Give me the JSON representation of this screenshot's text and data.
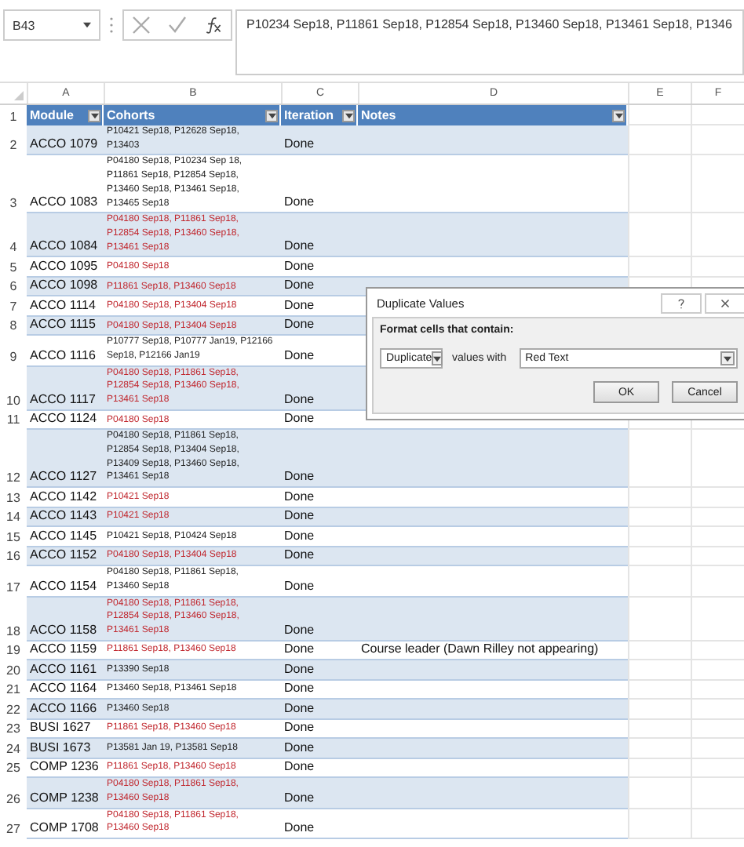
{
  "name_box": "B43",
  "formula": "P10234 Sep18, P11861 Sep18, P12854 Sep18, P13460 Sep18, P13461 Sep18, P1346",
  "columns": [
    "A",
    "B",
    "C",
    "D",
    "E",
    "F"
  ],
  "header": {
    "num": "1",
    "cells": [
      "Module",
      "Cohorts",
      "Iteration",
      "Notes"
    ]
  },
  "rows": [
    {
      "num": "2",
      "module": "ACCO 1079",
      "cohorts": "P10421 Sep18, P12628 Sep18,\nP13403",
      "duplicate": false,
      "iteration": "Done"
    },
    {
      "num": "3",
      "module": "ACCO 1083",
      "cohorts": "P04180 Sep18, P10234 Sep 18,\nP11861 Sep18, P12854 Sep18,\nP13460 Sep18, P13461 Sep18,\nP13465 Sep18",
      "duplicate": false,
      "iteration": "Done"
    },
    {
      "num": "4",
      "module": "ACCO 1084",
      "cohorts": "P04180 Sep18, P11861 Sep18,\nP12854 Sep18, P13460 Sep18,\nP13461 Sep18",
      "duplicate": true,
      "iteration": "Done"
    },
    {
      "num": "5",
      "module": "ACCO 1095",
      "cohorts": "P04180 Sep18",
      "duplicate": true,
      "iteration": "Done"
    },
    {
      "num": "6",
      "module": "ACCO 1098",
      "cohorts": "P11861 Sep18, P13460 Sep18",
      "duplicate": true,
      "iteration": "Done"
    },
    {
      "num": "7",
      "module": "ACCO 1114",
      "cohorts": "P04180 Sep18, P13404 Sep18",
      "duplicate": true,
      "iteration": "Done"
    },
    {
      "num": "8",
      "module": "ACCO 1115",
      "cohorts": "P04180 Sep18, P13404 Sep18",
      "duplicate": true,
      "iteration": "Done"
    },
    {
      "num": "9",
      "module": "ACCO 1116",
      "cohorts": "P10777 Sep18, P10777 Jan19, P12166\nSep18, P12166 Jan19",
      "duplicate": false,
      "iteration": "Done"
    },
    {
      "num": "10",
      "module": "ACCO 1117",
      "cohorts": "P04180 Sep18, P11861 Sep18,\nP12854 Sep18, P13460 Sep18,\nP13461 Sep18",
      "duplicate": true,
      "iteration": "Done"
    },
    {
      "num": "11",
      "module": "ACCO 1124",
      "cohorts": "P04180 Sep18",
      "duplicate": true,
      "iteration": "Done"
    },
    {
      "num": "12",
      "module": "ACCO 1127",
      "cohorts": "P04180 Sep18, P11861 Sep18,\nP12854 Sep18, P13404 Sep18,\nP13409 Sep18, P13460 Sep18,\nP13461 Sep18",
      "duplicate": false,
      "iteration": "Done"
    },
    {
      "num": "13",
      "module": "ACCO 1142",
      "cohorts": "P10421 Sep18",
      "duplicate": true,
      "iteration": "Done"
    },
    {
      "num": "14",
      "module": "ACCO 1143",
      "cohorts": "P10421 Sep18",
      "duplicate": true,
      "iteration": "Done"
    },
    {
      "num": "15",
      "module": "ACCO 1145",
      "cohorts": "P10421 Sep18, P10424 Sep18",
      "duplicate": false,
      "iteration": "Done"
    },
    {
      "num": "16",
      "module": "ACCO 1152",
      "cohorts": "P04180 Sep18, P13404 Sep18",
      "duplicate": true,
      "iteration": "Done"
    },
    {
      "num": "17",
      "module": "ACCO 1154",
      "cohorts": "P04180 Sep18, P11861 Sep18,\nP13460 Sep18",
      "duplicate": false,
      "iteration": "Done"
    },
    {
      "num": "18",
      "module": "ACCO 1158",
      "cohorts": "P04180 Sep18, P11861 Sep18,\nP12854 Sep18, P13460 Sep18,\nP13461 Sep18",
      "duplicate": true,
      "iteration": "Done"
    },
    {
      "num": "19",
      "module": "ACCO 1159",
      "cohorts": "P11861 Sep18, P13460 Sep18",
      "duplicate": true,
      "iteration": "Done",
      "notes": "Course leader (Dawn Rilley not appearing)"
    },
    {
      "num": "20",
      "module": "ACCO 1161",
      "cohorts": "P13390 Sep18",
      "duplicate": false,
      "iteration": "Done"
    },
    {
      "num": "21",
      "module": "ACCO 1164",
      "cohorts": "P13460 Sep18, P13461 Sep18",
      "duplicate": false,
      "iteration": "Done"
    },
    {
      "num": "22",
      "module": "ACCO 1166",
      "cohorts": "P13460 Sep18",
      "duplicate": false,
      "iteration": "Done"
    },
    {
      "num": "23",
      "module": "BUSI 1627",
      "cohorts": "P11861 Sep18, P13460 Sep18",
      "duplicate": true,
      "iteration": "Done"
    },
    {
      "num": "24",
      "module": "BUSI 1673",
      "cohorts": "P13581 Jan 19, P13581 Sep18",
      "duplicate": false,
      "iteration": "Done"
    },
    {
      "num": "25",
      "module": "COMP 1236",
      "cohorts": "P11861 Sep18, P13460 Sep18",
      "duplicate": true,
      "iteration": "Done"
    },
    {
      "num": "26",
      "module": "COMP 1238",
      "cohorts": "P04180 Sep18, P11861 Sep18,\nP13460 Sep18",
      "duplicate": true,
      "iteration": "Done"
    },
    {
      "num": "27",
      "module": "COMP 1708",
      "cohorts": "P04180 Sep18, P11861 Sep18,\nP13460 Sep18",
      "duplicate": true,
      "iteration": "Done"
    }
  ],
  "dialog": {
    "title": "Duplicate Values",
    "label": "Format cells that contain:",
    "rule": "Duplicate",
    "connector": "values with",
    "format": "Red Text",
    "buttons": [
      "OK",
      "Cancel"
    ]
  }
}
